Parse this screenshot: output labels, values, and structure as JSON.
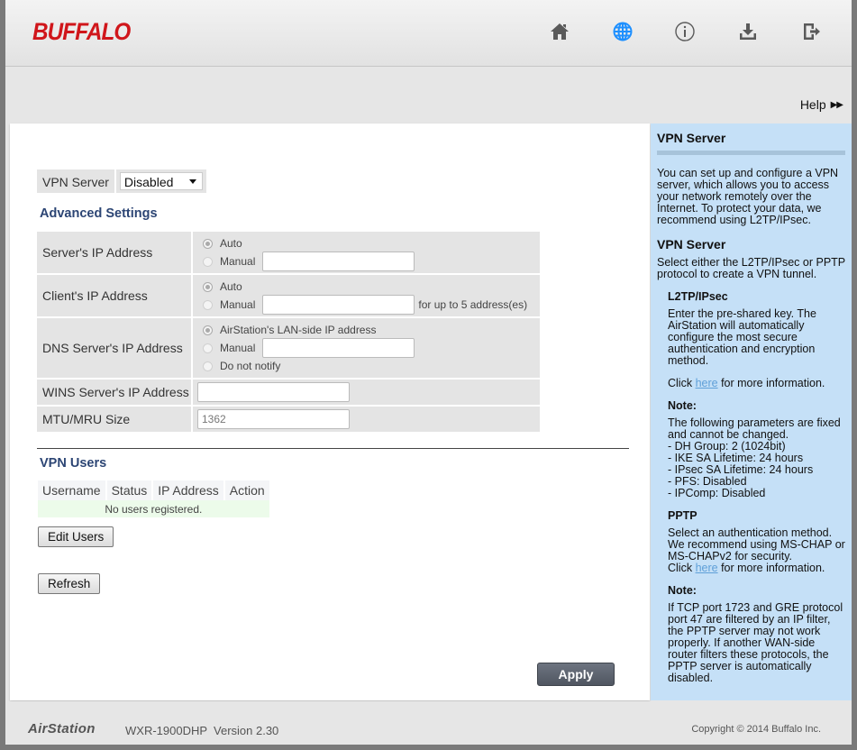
{
  "header": {
    "logo": "BUFFALO",
    "nav": [
      {
        "name": "home-icon",
        "label": "Home",
        "active": false
      },
      {
        "name": "globe-icon",
        "label": "Internet",
        "active": true
      },
      {
        "name": "info-icon",
        "label": "Status",
        "active": false
      },
      {
        "name": "download-icon",
        "label": "Update",
        "active": false
      },
      {
        "name": "logout-icon",
        "label": "Logout",
        "active": false
      }
    ],
    "active_color": "#1e90ff",
    "icon_color": "#5a5a5a"
  },
  "subbar": {
    "help_label": "Help",
    "help_arrows": "▶▶"
  },
  "vpn_server": {
    "label": "VPN Server",
    "selected": "Disabled"
  },
  "advanced": {
    "title": "Advanced Settings",
    "rows": {
      "server_ip": {
        "label": "Server's IP Address",
        "auto": "Auto",
        "manual": "Manual",
        "manual_value": ""
      },
      "client_ip": {
        "label": "Client's IP Address",
        "auto": "Auto",
        "manual": "Manual",
        "manual_value": "",
        "note": "for up to 5 address(es)"
      },
      "dns_ip": {
        "label": "DNS Server's IP Address",
        "lan": "AirStation's LAN-side IP address",
        "manual": "Manual",
        "manual_value": "",
        "none": "Do not notify"
      },
      "wins_ip": {
        "label": "WINS Server's IP Address",
        "value": ""
      },
      "mtu": {
        "label": "MTU/MRU Size",
        "value": "1362"
      }
    }
  },
  "users": {
    "title": "VPN Users",
    "columns": [
      "Username",
      "Status",
      "IP Address",
      "Action"
    ],
    "empty_message": "No users registered.",
    "edit_button": "Edit Users",
    "refresh_button": "Refresh"
  },
  "apply_button": "Apply",
  "help": {
    "title": "VPN Server",
    "intro": "You can set up and configure a VPN server, which allows you to access your network remotely over the Internet. To protect your data, we recommend using L2TP/IPsec.",
    "subtitle": "VPN Server",
    "select_text": "Select either the L2TP/IPsec or PPTP protocol to create a VPN tunnel.",
    "l2tp": {
      "title": "L2TP/IPsec",
      "text": "Enter the pre-shared key. The AirStation will automatically configure the most secure authentication and encryption method.",
      "click_prefix": "Click ",
      "link": "here",
      "click_suffix": " for more information.",
      "note_title": "Note:",
      "note_text": "The following parameters are fixed and cannot be changed.",
      "params": [
        "- DH Group: 2 (1024bit)",
        "- IKE SA Lifetime: 24 hours",
        "- IPsec SA Lifetime: 24 hours",
        "- PFS: Disabled",
        "- IPComp: Disabled"
      ]
    },
    "pptp": {
      "title": "PPTP",
      "text": "Select an authentication method. We recommend using MS-CHAP or MS-CHAPv2 for security.",
      "click_prefix": "Click ",
      "link": "here",
      "click_suffix": " for more information.",
      "note_title": "Note:",
      "note_text": "If TCP port 1723 and GRE protocol port 47 are filtered by an IP filter, the PPTP server may not work properly. If another WAN-side router filters these protocols, the PPTP server is automatically disabled."
    }
  },
  "footer": {
    "brand": "AirStation",
    "model": "WXR-1900DHP  Version 2.30",
    "copyright": "Copyright © 2014 Buffalo Inc."
  }
}
